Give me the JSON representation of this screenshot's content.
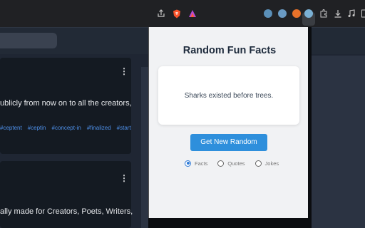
{
  "browser": {
    "toolbar_icons": [
      "share-icon",
      "brave-shield-icon",
      "brave-rewards-icon",
      "extension-icon",
      "extension-icon",
      "extension-icon",
      "extension-icon",
      "puzzle-icon",
      "download-icon",
      "media-icon",
      "sidepanel-icon"
    ]
  },
  "page": {
    "card1": {
      "text": "ublicly from now on to all the creators,",
      "tags": [
        "#ceptent",
        "#ceptin",
        "#concept-in",
        "#finalized",
        "#start"
      ]
    },
    "card2": {
      "text": "ally made for Creators, Poets, Writers,"
    }
  },
  "popup": {
    "title": "Random Fun Facts",
    "fact": "Sharks existed before trees.",
    "button_label": "Get New Random",
    "options": [
      {
        "label": "Facts",
        "checked": true
      },
      {
        "label": "Quotes",
        "checked": false
      },
      {
        "label": "Jokes",
        "checked": false
      }
    ]
  },
  "colors": {
    "button": "#2e8fdc",
    "title": "#1e2b3c",
    "tag_link": "#4d8fe8"
  }
}
